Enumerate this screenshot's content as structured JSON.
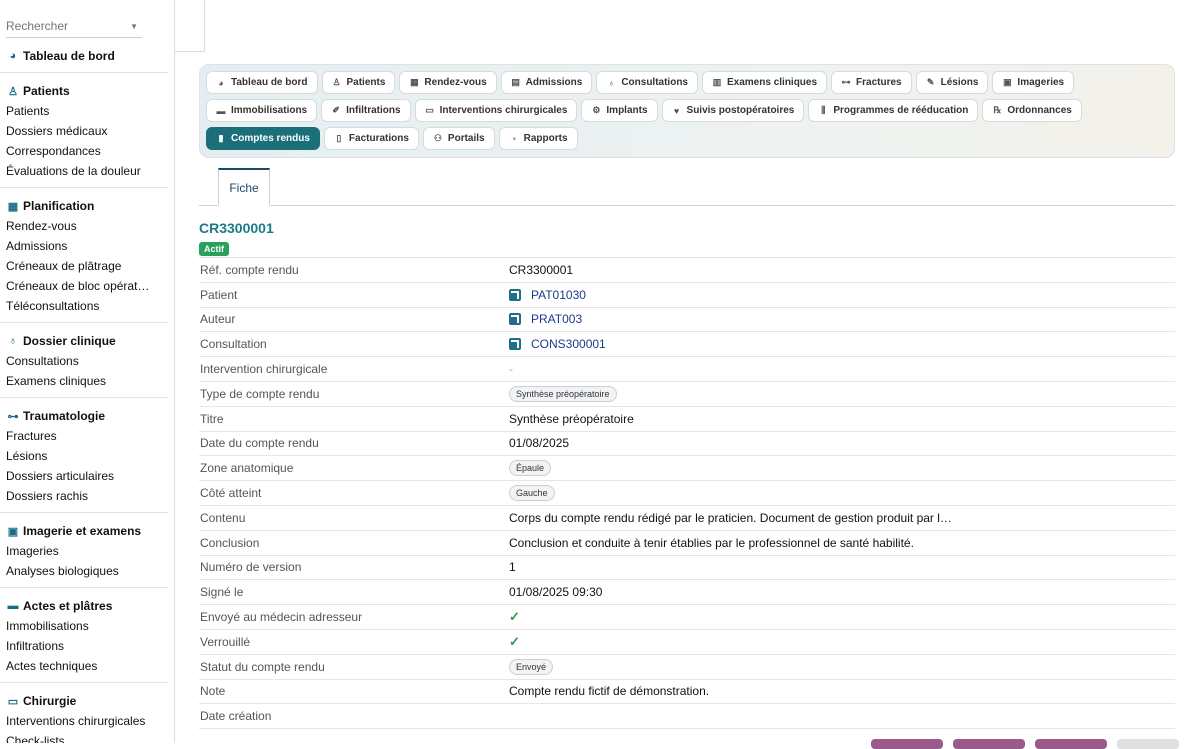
{
  "search": {
    "placeholder": "Rechercher"
  },
  "sidebar": {
    "sections": [
      {
        "title": "Tableau de bord",
        "icon": "gauge-icon",
        "items": []
      },
      {
        "title": "Patients",
        "icon": "user-icon",
        "items": [
          "Patients",
          "Dossiers médicaux",
          "Correspondances",
          "Évaluations de la douleur"
        ]
      },
      {
        "title": "Planification",
        "icon": "calendar-icon",
        "items": [
          "Rendez-vous",
          "Admissions",
          "Créneaux de plâtrage",
          "Créneaux de bloc opérat…",
          "Téléconsultations"
        ]
      },
      {
        "title": "Dossier clinique",
        "icon": "stethoscope-icon",
        "items": [
          "Consultations",
          "Examens cliniques"
        ]
      },
      {
        "title": "Traumatologie",
        "icon": "bone-icon",
        "items": [
          "Fractures",
          "Lésions",
          "Dossiers articulaires",
          "Dossiers rachis"
        ]
      },
      {
        "title": "Imagerie et examens",
        "icon": "xray-icon",
        "items": [
          "Imageries",
          "Analyses biologiques"
        ]
      },
      {
        "title": "Actes et plâtres",
        "icon": "bandage-icon",
        "items": [
          "Immobilisations",
          "Infiltrations",
          "Actes techniques"
        ]
      },
      {
        "title": "Chirurgie",
        "icon": "bed-icon",
        "items": [
          "Interventions chirurgicales",
          "Check-lists"
        ]
      }
    ]
  },
  "nav": {
    "buttons": [
      {
        "label": "Tableau de bord",
        "icon": "gauge-icon",
        "glyph": "◕"
      },
      {
        "label": "Patients",
        "icon": "user-icon",
        "glyph": "♙"
      },
      {
        "label": "Rendez-vous",
        "icon": "calendar-icon",
        "glyph": "▦"
      },
      {
        "label": "Admissions",
        "icon": "clipboard-icon",
        "glyph": "▤"
      },
      {
        "label": "Consultations",
        "icon": "stethoscope-icon",
        "glyph": "♁"
      },
      {
        "label": "Examens cliniques",
        "icon": "clipboard-list-icon",
        "glyph": "▥"
      },
      {
        "label": "Fractures",
        "icon": "bone-icon",
        "glyph": "⊶"
      },
      {
        "label": "Lésions",
        "icon": "wand-icon",
        "glyph": "✎"
      },
      {
        "label": "Imageries",
        "icon": "xray-icon",
        "glyph": "▣"
      },
      {
        "label": "Immobilisations",
        "icon": "bandage-icon",
        "glyph": "▬"
      },
      {
        "label": "Infiltrations",
        "icon": "syringe-icon",
        "glyph": "✐"
      },
      {
        "label": "Interventions chirurgicales",
        "icon": "bed-icon",
        "glyph": "▭"
      },
      {
        "label": "Implants",
        "icon": "gears-icon",
        "glyph": "⚙"
      },
      {
        "label": "Suivis postopératoires",
        "icon": "heart-icon",
        "glyph": "♥"
      },
      {
        "label": "Programmes de rééducation",
        "icon": "dumbbell-icon",
        "glyph": "⫼"
      },
      {
        "label": "Ordonnances",
        "icon": "prescription-icon",
        "glyph": "℞"
      },
      {
        "label": "Comptes rendus",
        "icon": "file-icon",
        "glyph": "▮",
        "active": true
      },
      {
        "label": "Facturations",
        "icon": "invoice-icon",
        "glyph": "▯"
      },
      {
        "label": "Portails",
        "icon": "users-icon",
        "glyph": "⚇"
      },
      {
        "label": "Rapports",
        "icon": "chart-pie-icon",
        "glyph": "◔"
      }
    ]
  },
  "tabs": {
    "fiche": "Fiche"
  },
  "record": {
    "id": "CR3300001",
    "status_badge": "Actif",
    "fields": [
      {
        "label": "Réf. compte rendu",
        "type": "text",
        "value": "CR3300001"
      },
      {
        "label": "Patient",
        "type": "link",
        "value": "PAT01030"
      },
      {
        "label": "Auteur",
        "type": "link",
        "value": "PRAT003"
      },
      {
        "label": "Consultation",
        "type": "link",
        "value": "CONS300001"
      },
      {
        "label": "Intervention chirurgicale",
        "type": "dash",
        "value": "-"
      },
      {
        "label": "Type de compte rendu",
        "type": "pill",
        "value": "Synthèse préopératoire"
      },
      {
        "label": "Titre",
        "type": "text",
        "value": "Synthèse préopératoire"
      },
      {
        "label": "Date du compte rendu",
        "type": "text",
        "value": "01/08/2025"
      },
      {
        "label": "Zone anatomique",
        "type": "pill",
        "value": "Épaule"
      },
      {
        "label": "Côté atteint",
        "type": "pill",
        "value": "Gauche"
      },
      {
        "label": "Contenu",
        "type": "text",
        "value": "Corps du compte rendu rédigé par le praticien. Document de gestion produit par l…"
      },
      {
        "label": "Conclusion",
        "type": "text",
        "value": "Conclusion et conduite à tenir établies par le professionnel de santé habilité."
      },
      {
        "label": "Numéro de version",
        "type": "text",
        "value": "1"
      },
      {
        "label": "Signé le",
        "type": "text",
        "value": "01/08/2025 09:30"
      },
      {
        "label": "Envoyé au médecin adresseur",
        "type": "check",
        "value": "✓"
      },
      {
        "label": "Verrouillé",
        "type": "check",
        "value": "✓"
      },
      {
        "label": "Statut du compte rendu",
        "type": "pill",
        "value": "Envoyé"
      },
      {
        "label": "Note",
        "type": "text",
        "value": "Compte rendu fictif de démonstration."
      },
      {
        "label": "Date création",
        "type": "text",
        "value": ""
      }
    ]
  }
}
